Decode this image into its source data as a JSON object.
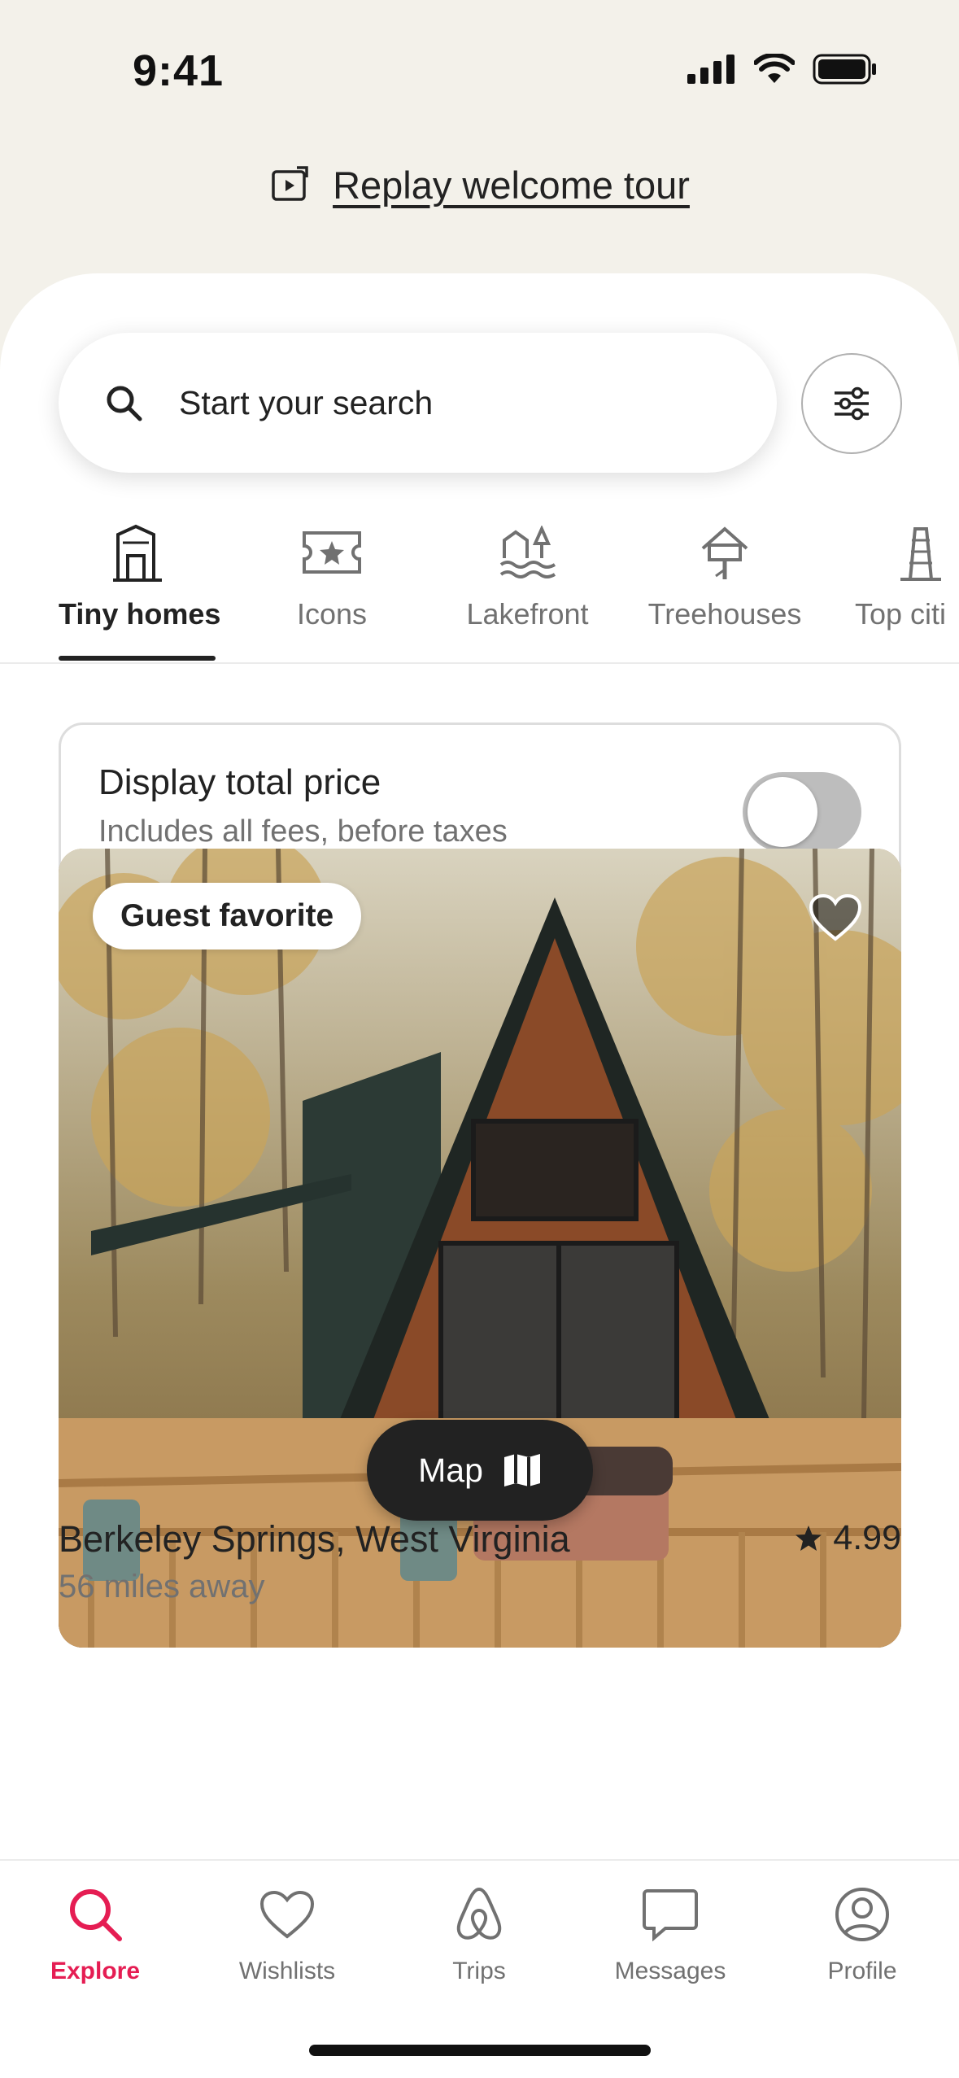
{
  "status_bar": {
    "time": "9:41",
    "icons": [
      "signal-icon",
      "wifi-icon",
      "battery-icon"
    ]
  },
  "welcome": {
    "replay_label": "Replay welcome tour",
    "icon": "replay-icon"
  },
  "search": {
    "placeholder": "Start your search",
    "icon": "search-icon",
    "filter_icon": "filter-sliders-icon"
  },
  "categories": [
    {
      "label": "Tiny homes",
      "icon": "tiny-home-icon",
      "active": true
    },
    {
      "label": "Icons",
      "icon": "star-ticket-icon",
      "active": false
    },
    {
      "label": "Lakefront",
      "icon": "lakefront-icon",
      "active": false
    },
    {
      "label": "Treehouses",
      "icon": "treehouse-icon",
      "active": false
    },
    {
      "label": "Top citi",
      "icon": "tower-icon",
      "active": false
    }
  ],
  "price_toggle": {
    "title": "Display total price",
    "subtitle": "Includes all fees, before taxes",
    "enabled": false
  },
  "listing": {
    "badge": "Guest favorite",
    "title": "Berkeley Springs, West Virginia",
    "rating": "4.99",
    "distance": "56 miles away",
    "photo_alt": "A-frame cabin in autumn woods"
  },
  "map_button": {
    "label": "Map",
    "icon": "map-icon"
  },
  "tabs": [
    {
      "label": "Explore",
      "icon": "search-icon",
      "active": true
    },
    {
      "label": "Wishlists",
      "icon": "heart-outline-icon",
      "active": false
    },
    {
      "label": "Trips",
      "icon": "airbnb-logo-icon",
      "active": false
    },
    {
      "label": "Messages",
      "icon": "message-icon",
      "active": false
    },
    {
      "label": "Profile",
      "icon": "profile-icon",
      "active": false
    }
  ],
  "colors": {
    "accent": "#e51d53",
    "background": "#f3f1ea",
    "text": "#222222",
    "muted": "#717171"
  }
}
